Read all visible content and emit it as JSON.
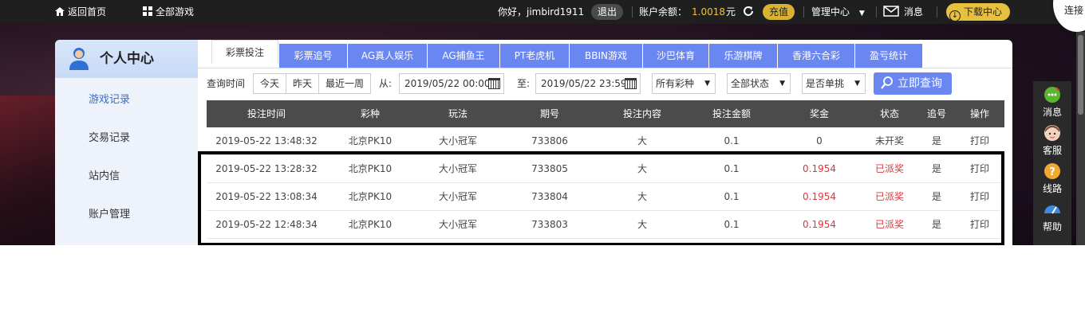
{
  "topbar": {
    "home": "返回首页",
    "all_games": "全部游戏",
    "greeting": "你好，jimbird1911",
    "logout": "退出",
    "balance_label": "账户余额：",
    "balance_value": "1.0018",
    "balance_unit": "元",
    "recharge": "充值",
    "manage": "管理中心",
    "messages": "消息",
    "download": "下载中心",
    "corner_text": "连接"
  },
  "sidebar": {
    "title": "个人中心",
    "items": [
      {
        "label": "游戏记录",
        "active": true
      },
      {
        "label": "交易记录"
      },
      {
        "label": "站内信"
      },
      {
        "label": "账户管理"
      }
    ]
  },
  "tabs": [
    "彩票投注",
    "彩票追号",
    "AG真人娱乐",
    "AG捕鱼王",
    "PT老虎机",
    "BBIN游戏",
    "沙巴体育",
    "乐游棋牌",
    "香港六合彩",
    "盈亏统计"
  ],
  "filters": {
    "query_time_label": "查询时间",
    "quick": [
      "今天",
      "昨天",
      "最近一周"
    ],
    "from_label": "从:",
    "from_value": "2019/05/22 00:00",
    "to_label": "至:",
    "to_value": "2019/05/22 23:59",
    "lottery_select": "所有彩种",
    "status_select": "全部状态",
    "single_select": "是否单挑",
    "query_button": "立即查询"
  },
  "table": {
    "headers": [
      "投注时间",
      "彩种",
      "玩法",
      "期号",
      "投注内容",
      "投注金额",
      "奖金",
      "状态",
      "追号",
      "操作"
    ],
    "rows": [
      [
        "2019-05-22 13:48:32",
        "北京PK10",
        "大小冠军",
        "733806",
        "大",
        "0.1",
        "0",
        "未开奖",
        "是",
        "打印"
      ],
      [
        "2019-05-22 13:28:32",
        "北京PK10",
        "大小冠军",
        "733805",
        "大",
        "0.1",
        "0.1954",
        "已派奖",
        "是",
        "打印"
      ],
      [
        "2019-05-22 13:08:34",
        "北京PK10",
        "大小冠军",
        "733804",
        "大",
        "0.1",
        "0.1954",
        "已派奖",
        "是",
        "打印"
      ],
      [
        "2019-05-22 12:48:34",
        "北京PK10",
        "大小冠军",
        "733803",
        "大",
        "0.1",
        "0.1954",
        "已派奖",
        "是",
        "打印"
      ]
    ]
  },
  "right_float": [
    "消息",
    "客服",
    "线路",
    "帮助"
  ],
  "colors": {
    "accent": "#6a86f0",
    "win": "#e0353a",
    "gold": "#e6c13f"
  }
}
